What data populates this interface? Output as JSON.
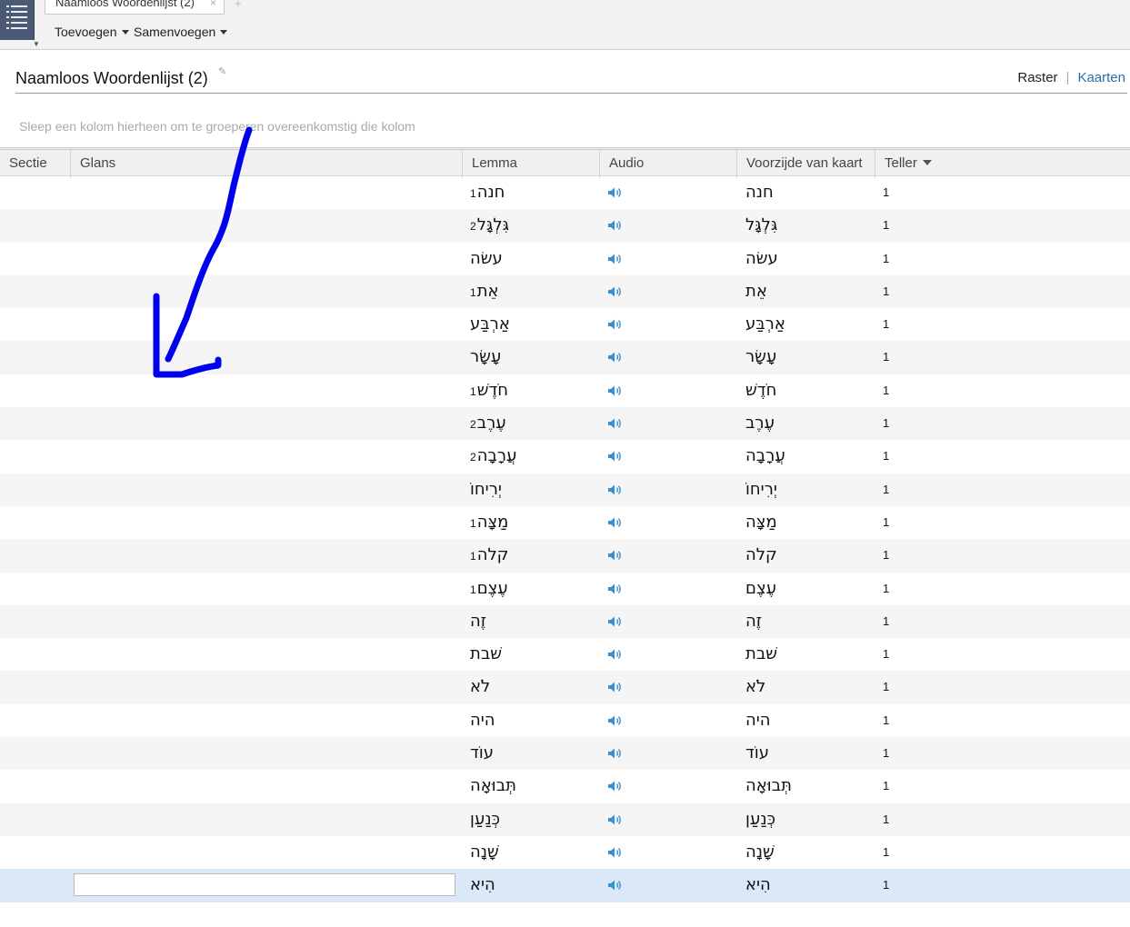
{
  "tab": {
    "label": "Naamloos Woordenlijst (2)",
    "close": "×",
    "new": "+"
  },
  "toolbar": {
    "add_label": "Toevoegen",
    "merge_label": "Samenvoegen"
  },
  "page": {
    "title": "Naamloos Woordenlijst (2)",
    "view_grid": "Raster",
    "view_separator": "|",
    "view_cards": "Kaarten"
  },
  "group_hint": "Sleep een kolom hierheen om te groeperen overeenkomstig die kolom",
  "columns": {
    "section": "Sectie",
    "gloss": "Glans",
    "lemma": "Lemma",
    "audio": "Audio",
    "front": "Voorzijde van kaart",
    "count": "Teller"
  },
  "colors": {
    "accent": "#2a6fa8",
    "audio_icon": "#3a8fd0",
    "selected_row": "#dbe8f7",
    "annotation": "#0000ee"
  },
  "rows": [
    {
      "lemma": "חנה",
      "hom": "1",
      "front": "חנה",
      "count": "1"
    },
    {
      "lemma": "גִּלְגָּל",
      "hom": "2",
      "front": "גִּלְגָּל",
      "count": "1"
    },
    {
      "lemma": "עשׂה",
      "hom": "",
      "front": "עשׂה",
      "count": "1"
    },
    {
      "lemma": "אֵת",
      "hom": "1",
      "front": "אֵת",
      "count": "1"
    },
    {
      "lemma": "אַרְבַּע",
      "hom": "",
      "front": "אַרְבַּע",
      "count": "1"
    },
    {
      "lemma": "עָשָׂר",
      "hom": "",
      "front": "עָשָׂר",
      "count": "1"
    },
    {
      "lemma": "חֹדֶשׁ",
      "hom": "1",
      "front": "חֹדֶשׁ",
      "count": "1"
    },
    {
      "lemma": "עֶרֶב",
      "hom": "2",
      "front": "עֶרֶב",
      "count": "1"
    },
    {
      "lemma": "עֲרָבָה",
      "hom": "2",
      "front": "עֲרָבָה",
      "count": "1"
    },
    {
      "lemma": "יְרִיחוֹ",
      "hom": "",
      "front": "יְרִיחוֹ",
      "count": "1"
    },
    {
      "lemma": "מַצָּה",
      "hom": "1",
      "front": "מַצָּה",
      "count": "1"
    },
    {
      "lemma": "קלה",
      "hom": "1",
      "front": "קלה",
      "count": "1"
    },
    {
      "lemma": "עֶצֶם",
      "hom": "1",
      "front": "עֶצֶם",
      "count": "1"
    },
    {
      "lemma": "זֶה",
      "hom": "",
      "front": "זֶה",
      "count": "1"
    },
    {
      "lemma": "שׁבת",
      "hom": "",
      "front": "שׁבת",
      "count": "1"
    },
    {
      "lemma": "לֹא",
      "hom": "",
      "front": "לֹא",
      "count": "1"
    },
    {
      "lemma": "היה",
      "hom": "",
      "front": "היה",
      "count": "1"
    },
    {
      "lemma": "עוֹד",
      "hom": "",
      "front": "עוֹד",
      "count": "1"
    },
    {
      "lemma": "תְּבוּאָה",
      "hom": "",
      "front": "תְּבוּאָה",
      "count": "1"
    },
    {
      "lemma": "כְּנַעַן",
      "hom": "",
      "front": "כְּנַעַן",
      "count": "1"
    },
    {
      "lemma": "שָׁנָה",
      "hom": "",
      "front": "שָׁנָה",
      "count": "1"
    },
    {
      "lemma": "הִיא",
      "hom": "",
      "front": "הִיא",
      "count": "1",
      "selected": true,
      "gloss_value": ""
    }
  ]
}
